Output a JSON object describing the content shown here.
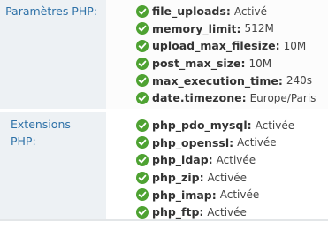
{
  "php_section": {
    "label": "Paramètres PHP:",
    "items": [
      {
        "key": "file_uploads",
        "value": "Activé"
      },
      {
        "key": "memory_limit",
        "value": "512M"
      },
      {
        "key": "upload_max_filesize",
        "value": "10M"
      },
      {
        "key": "post_max_size",
        "value": "10M"
      },
      {
        "key": "max_execution_time",
        "value": "240s"
      },
      {
        "key": "date.timezone",
        "value": "Europe/Paris"
      }
    ]
  },
  "extensions_section": {
    "label": "Extensions PHP:",
    "items": [
      {
        "key": "php_pdo_mysql",
        "value": "Activée"
      },
      {
        "key": "php_openssl",
        "value": "Activée"
      },
      {
        "key": "php_ldap",
        "value": "Activée"
      },
      {
        "key": "php_zip",
        "value": "Activée"
      },
      {
        "key": "php_imap",
        "value": "Activée"
      },
      {
        "key": "php_ftp",
        "value": "Activée"
      }
    ]
  },
  "icons": {
    "status": "check-circle-icon"
  },
  "colors": {
    "label_text": "#2f72a8",
    "check_green": "#4ea232",
    "label_bg": "#edf1f4"
  }
}
